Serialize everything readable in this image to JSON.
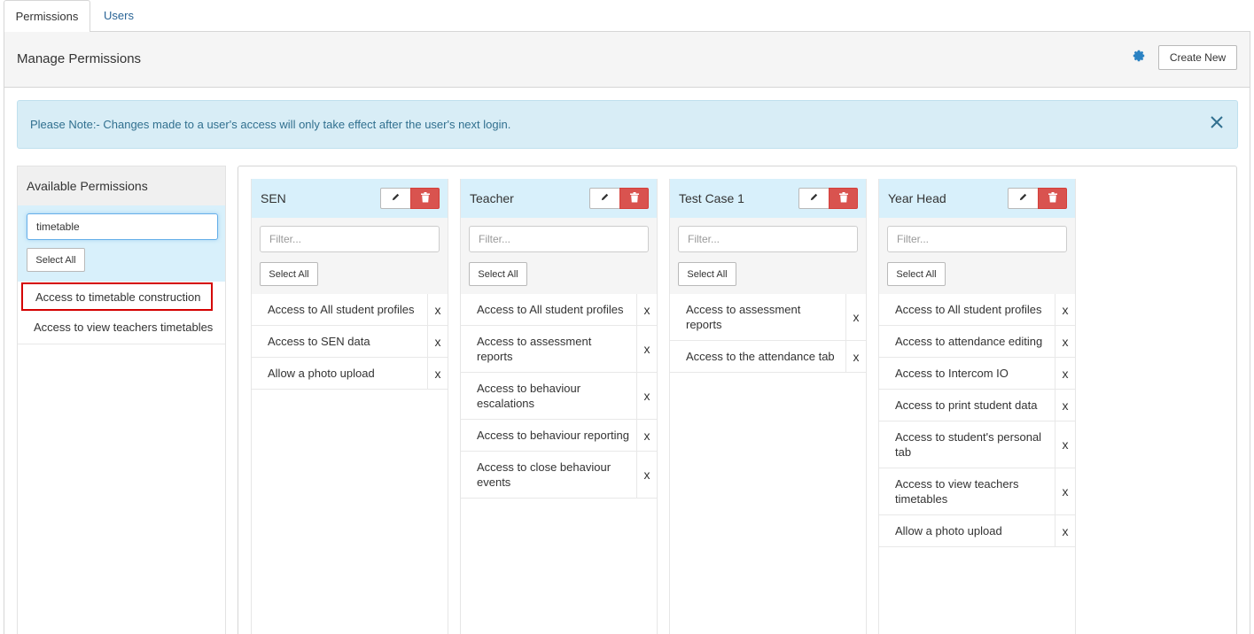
{
  "tabs": [
    {
      "label": "Permissions"
    },
    {
      "label": "Users"
    }
  ],
  "header": {
    "title": "Manage Permissions",
    "create_label": "Create New"
  },
  "alert": {
    "text": "Please Note:- Changes made to a user's access will only take effect after the user's next login."
  },
  "available": {
    "title": "Available Permissions",
    "search_value": "timetable",
    "select_all_label": "Select All",
    "items": [
      {
        "label": "Access to timetable construction"
      },
      {
        "label": "Access to view teachers timetables"
      }
    ]
  },
  "roles": [
    {
      "name": "SEN",
      "filter_placeholder": "Filter...",
      "select_all_label": "Select All",
      "permissions": [
        "Access to All student profiles",
        "Access to SEN data",
        "Allow a photo upload"
      ]
    },
    {
      "name": "Teacher",
      "filter_placeholder": "Filter...",
      "select_all_label": "Select All",
      "permissions": [
        "Access to All student profiles",
        "Access to assessment reports",
        "Access to behaviour escalations",
        "Access to behaviour reporting",
        "Access to close behaviour events"
      ]
    },
    {
      "name": "Test Case 1",
      "filter_placeholder": "Filter...",
      "select_all_label": "Select All",
      "permissions": [
        "Access to assessment reports",
        "Access to the attendance tab"
      ]
    },
    {
      "name": "Year Head",
      "filter_placeholder": "Filter...",
      "select_all_label": "Select All",
      "permissions": [
        "Access to All student profiles",
        "Access to attendance editing",
        "Access to Intercom IO",
        "Access to print student data",
        "Access to student's personal tab",
        "Access to view teachers timetables",
        "Allow a photo upload"
      ]
    }
  ],
  "remove_glyph": "x",
  "icons": {
    "settings": "gear-icon",
    "close": "close-icon",
    "edit": "pencil-icon",
    "delete": "trash-icon"
  },
  "colors": {
    "link": "#2a6496",
    "alert_bg": "#d8edf6",
    "role_header_bg": "#d8f0fb",
    "delete_btn": "#d9534f",
    "highlight_border": "#d40000",
    "gear": "#2a82c3"
  }
}
